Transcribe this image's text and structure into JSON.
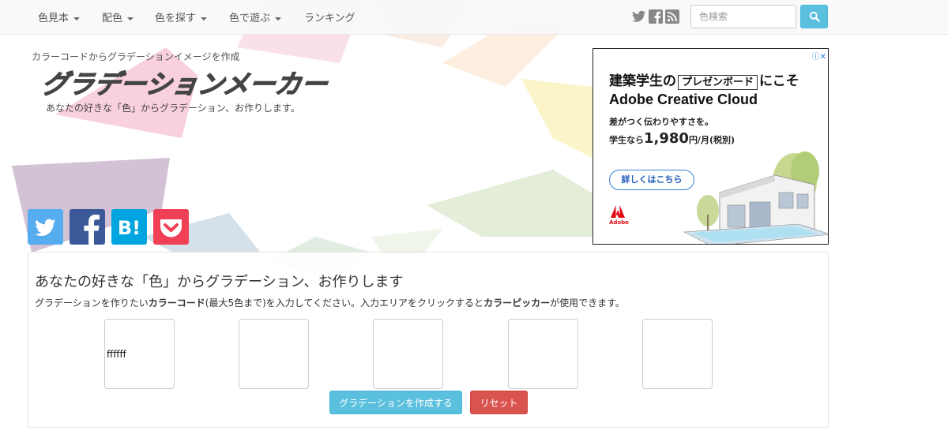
{
  "nav": {
    "items": [
      {
        "label": "色見本",
        "dropdown": true
      },
      {
        "label": "配色",
        "dropdown": true
      },
      {
        "label": "色を探す",
        "dropdown": true
      },
      {
        "label": "色で遊ぶ",
        "dropdown": true
      },
      {
        "label": "ランキング",
        "dropdown": false
      }
    ],
    "social_icons": [
      "twitter-icon",
      "facebook-icon",
      "rss-icon"
    ],
    "search": {
      "placeholder": "色検索",
      "value": "",
      "button_icon": "search-icon"
    }
  },
  "header": {
    "tagline": "カラーコードからグラデーションイメージを作成",
    "logo_text": "グラデーションメーカー",
    "subtitle": "あなたの好きな「色」からグラデーション、お作りします。"
  },
  "share_buttons": [
    {
      "name": "twitter-share",
      "icon": "twitter-icon",
      "color": "#55acee"
    },
    {
      "name": "facebook-share",
      "icon": "facebook-icon",
      "color": "#3b5998"
    },
    {
      "name": "hatena-share",
      "icon": "hatena-bookmark-icon",
      "label": "B!",
      "color": "#00a4de"
    },
    {
      "name": "pocket-share",
      "icon": "pocket-icon",
      "color": "#ef4056"
    }
  ],
  "ad": {
    "line1_pre": "建築学生の",
    "line1_boxed": "プレゼンボード",
    "line1_post": "にこそ",
    "line2": "Adobe Creative Cloud",
    "line3": "差がつく伝わりやすさを。",
    "line4_pre": "学生なら",
    "line4_price": "1,980",
    "line4_post": "円/月(税別)",
    "cta": "詳しくはこちら",
    "brand": "Adobe"
  },
  "panel": {
    "title": "あなたの好きな「色」からグラデーション、お作りします",
    "desc_1": "グラデーションを作りたい",
    "desc_bold_1": "カラーコード",
    "desc_2": "(最大5色まで)を入力してください。入力エリアをクリックすると",
    "desc_bold_2": "カラーピッカー",
    "desc_3": "が使用できます。",
    "color_inputs": [
      "ffffff",
      "",
      "",
      "",
      ""
    ],
    "create_label": "グラデーションを作成する",
    "reset_label": "リセット"
  },
  "colors": {
    "nav_bg": "#f8f8f8",
    "info": "#5bc0de",
    "danger": "#d9534f",
    "twitter": "#55acee",
    "facebook": "#3b5998",
    "hatena": "#00a4de",
    "pocket": "#ef4056"
  }
}
